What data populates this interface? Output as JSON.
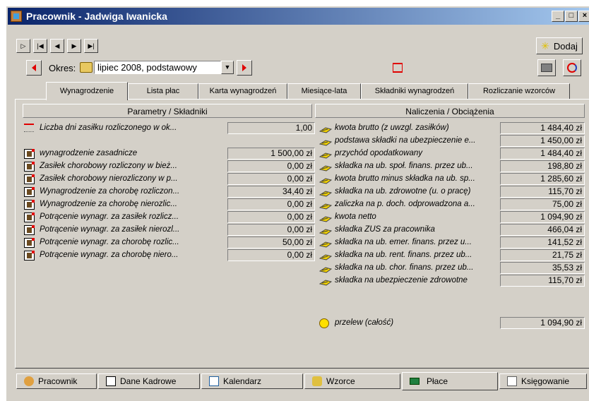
{
  "window": {
    "title": "Pracownik - Jadwiga Iwanicka"
  },
  "toolbar": {
    "add_label": "Dodaj"
  },
  "period": {
    "label": "Okres:",
    "value": "lipiec 2008, podstawowy"
  },
  "tabs": [
    {
      "label": "Wynagrodzenie"
    },
    {
      "label": "Lista płac"
    },
    {
      "label": "Karta wynagrodzeń"
    },
    {
      "label": "Miesiące-lata"
    },
    {
      "label": "Składniki wynagrodzeń"
    },
    {
      "label": "Rozliczanie wzorców"
    }
  ],
  "left": {
    "header": "Parametry / Składniki",
    "rows": [
      {
        "label": "Liczba dni zasiłku rozliczonego w ok...",
        "value": "1,00",
        "icon": "calendar-icon"
      },
      {
        "label": "wynagrodzenie zasadnicze",
        "value": "1 500,00 zł",
        "icon": "document-icon"
      },
      {
        "label": "Zasiłek chorobowy rozliczony w bież...",
        "value": "0,00 zł",
        "icon": "document-icon"
      },
      {
        "label": "Zasiłek chorobowy nierozliczony w p...",
        "value": "0,00 zł",
        "icon": "document-icon"
      },
      {
        "label": "Wynagrodzenie za chorobę rozliczon...",
        "value": "34,40 zł",
        "icon": "document-icon"
      },
      {
        "label": "Wynagrodzenie za chorobę nierozlic...",
        "value": "0,00 zł",
        "icon": "document-icon"
      },
      {
        "label": "Potrącenie wynagr. za zasiłek rozlicz...",
        "value": "0,00 zł",
        "icon": "document-icon"
      },
      {
        "label": "Potrącenie wynagr. za zasiłek nierozl...",
        "value": "0,00 zł",
        "icon": "document-icon"
      },
      {
        "label": "Potrącenie wynagr. za chorobę rozlic...",
        "value": "50,00 zł",
        "icon": "document-icon"
      },
      {
        "label": "Potrącenie wynagr. za chorobę niero...",
        "value": "0,00 zł",
        "icon": "document-icon"
      }
    ]
  },
  "right": {
    "header": "Naliczenia / Obciążenia",
    "rows": [
      {
        "label": "kwota brutto (z uwzgl. zasiłków)",
        "value": "1 484,40 zł"
      },
      {
        "label": "podstawa składki na ubezpieczenie e...",
        "value": "1 450,00 zł"
      },
      {
        "label": "przychód opodatkowany",
        "value": "1 484,40 zł"
      },
      {
        "label": "składka na ub. społ. finans. przez ub...",
        "value": "198,80 zł"
      },
      {
        "label": "kwota brutto minus składka na ub. sp...",
        "value": "1 285,60 zł"
      },
      {
        "label": "składka na ub. zdrowotne (u. o pracę)",
        "value": "115,70 zł"
      },
      {
        "label": "zaliczka na p. doch. odprowadzona a...",
        "value": "75,00 zł"
      },
      {
        "label": "kwota netto",
        "value": "1 094,90 zł"
      },
      {
        "label": "składka ZUS za pracownika",
        "value": "466,04 zł"
      },
      {
        "label": "składka na ub. emer. finans. przez u...",
        "value": "141,52 zł"
      },
      {
        "label": "składka na ub. rent. finans. przez ub...",
        "value": "21,75 zł"
      },
      {
        "label": "składka na ub. chor. finans. przez ub...",
        "value": "35,53 zł"
      },
      {
        "label": "składka na ubezpieczenie zdrowotne",
        "value": "115,70 zł"
      }
    ],
    "transfer": {
      "label": "przelew (całość)",
      "value": "1 094,90 zł"
    }
  },
  "bottom_tabs": [
    {
      "label": "Pracownik"
    },
    {
      "label": "Dane Kadrowe"
    },
    {
      "label": "Kalendarz"
    },
    {
      "label": "Wzorce"
    },
    {
      "label": "Płace"
    },
    {
      "label": "Księgowanie"
    }
  ],
  "colors": {
    "title_start": "#0a246a",
    "title_end": "#a6caf0",
    "arrow_red": "#e00000",
    "face": "#d4d0c8"
  }
}
